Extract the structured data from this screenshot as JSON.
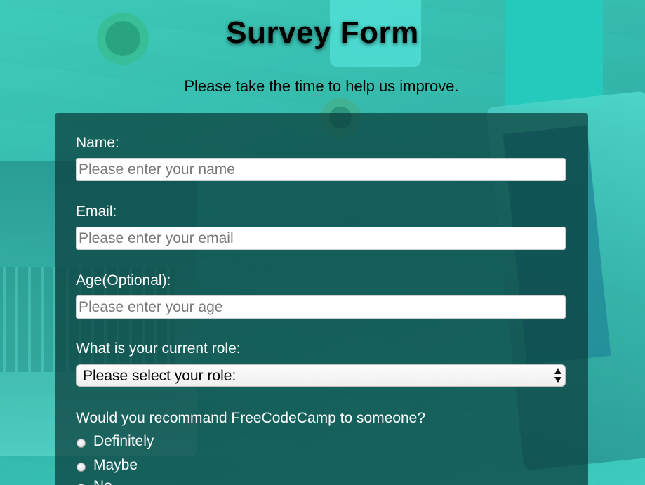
{
  "header": {
    "title": "Survey Form",
    "description": "Please take the time to help us improve."
  },
  "form": {
    "name": {
      "label": "Name:",
      "placeholder": "Please enter your name",
      "value": ""
    },
    "email": {
      "label": "Email:",
      "placeholder": "Please enter your email",
      "value": ""
    },
    "age": {
      "label": "Age(Optional):",
      "placeholder": "Please enter your age",
      "value": ""
    },
    "role": {
      "label": "What is your current role:",
      "selected": "Please select your role:"
    },
    "recommend": {
      "question": "Would you recommand FreeCodeCamp to someone?",
      "options": [
        {
          "label": "Definitely",
          "checked": false
        },
        {
          "label": "Maybe",
          "checked": false
        },
        {
          "label": "No",
          "checked": false
        }
      ]
    }
  },
  "colors": {
    "panel": "#0a3c3a",
    "background": "#3ec3b3",
    "text_light": "#ffffff",
    "title": "#000000"
  }
}
